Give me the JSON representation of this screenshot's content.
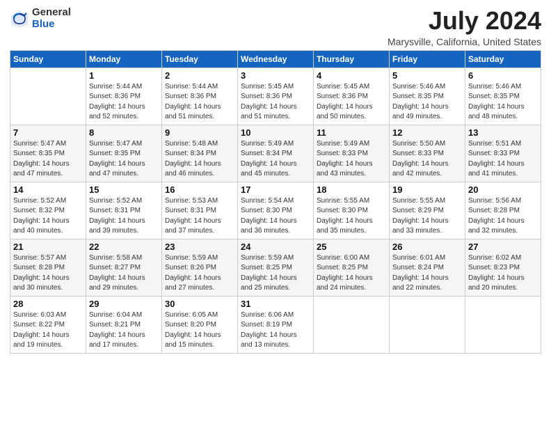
{
  "logo": {
    "general": "General",
    "blue": "Blue"
  },
  "title": {
    "month_year": "July 2024",
    "location": "Marysville, California, United States"
  },
  "headers": [
    "Sunday",
    "Monday",
    "Tuesday",
    "Wednesday",
    "Thursday",
    "Friday",
    "Saturday"
  ],
  "weeks": [
    [
      {
        "day": "",
        "sunrise": "",
        "sunset": "",
        "daylight": ""
      },
      {
        "day": "1",
        "sunrise": "Sunrise: 5:44 AM",
        "sunset": "Sunset: 8:36 PM",
        "daylight": "Daylight: 14 hours and 52 minutes."
      },
      {
        "day": "2",
        "sunrise": "Sunrise: 5:44 AM",
        "sunset": "Sunset: 8:36 PM",
        "daylight": "Daylight: 14 hours and 51 minutes."
      },
      {
        "day": "3",
        "sunrise": "Sunrise: 5:45 AM",
        "sunset": "Sunset: 8:36 PM",
        "daylight": "Daylight: 14 hours and 51 minutes."
      },
      {
        "day": "4",
        "sunrise": "Sunrise: 5:45 AM",
        "sunset": "Sunset: 8:36 PM",
        "daylight": "Daylight: 14 hours and 50 minutes."
      },
      {
        "day": "5",
        "sunrise": "Sunrise: 5:46 AM",
        "sunset": "Sunset: 8:35 PM",
        "daylight": "Daylight: 14 hours and 49 minutes."
      },
      {
        "day": "6",
        "sunrise": "Sunrise: 5:46 AM",
        "sunset": "Sunset: 8:35 PM",
        "daylight": "Daylight: 14 hours and 48 minutes."
      }
    ],
    [
      {
        "day": "7",
        "sunrise": "Sunrise: 5:47 AM",
        "sunset": "Sunset: 8:35 PM",
        "daylight": "Daylight: 14 hours and 47 minutes."
      },
      {
        "day": "8",
        "sunrise": "Sunrise: 5:47 AM",
        "sunset": "Sunset: 8:35 PM",
        "daylight": "Daylight: 14 hours and 47 minutes."
      },
      {
        "day": "9",
        "sunrise": "Sunrise: 5:48 AM",
        "sunset": "Sunset: 8:34 PM",
        "daylight": "Daylight: 14 hours and 46 minutes."
      },
      {
        "day": "10",
        "sunrise": "Sunrise: 5:49 AM",
        "sunset": "Sunset: 8:34 PM",
        "daylight": "Daylight: 14 hours and 45 minutes."
      },
      {
        "day": "11",
        "sunrise": "Sunrise: 5:49 AM",
        "sunset": "Sunset: 8:33 PM",
        "daylight": "Daylight: 14 hours and 43 minutes."
      },
      {
        "day": "12",
        "sunrise": "Sunrise: 5:50 AM",
        "sunset": "Sunset: 8:33 PM",
        "daylight": "Daylight: 14 hours and 42 minutes."
      },
      {
        "day": "13",
        "sunrise": "Sunrise: 5:51 AM",
        "sunset": "Sunset: 8:33 PM",
        "daylight": "Daylight: 14 hours and 41 minutes."
      }
    ],
    [
      {
        "day": "14",
        "sunrise": "Sunrise: 5:52 AM",
        "sunset": "Sunset: 8:32 PM",
        "daylight": "Daylight: 14 hours and 40 minutes."
      },
      {
        "day": "15",
        "sunrise": "Sunrise: 5:52 AM",
        "sunset": "Sunset: 8:31 PM",
        "daylight": "Daylight: 14 hours and 39 minutes."
      },
      {
        "day": "16",
        "sunrise": "Sunrise: 5:53 AM",
        "sunset": "Sunset: 8:31 PM",
        "daylight": "Daylight: 14 hours and 37 minutes."
      },
      {
        "day": "17",
        "sunrise": "Sunrise: 5:54 AM",
        "sunset": "Sunset: 8:30 PM",
        "daylight": "Daylight: 14 hours and 36 minutes."
      },
      {
        "day": "18",
        "sunrise": "Sunrise: 5:55 AM",
        "sunset": "Sunset: 8:30 PM",
        "daylight": "Daylight: 14 hours and 35 minutes."
      },
      {
        "day": "19",
        "sunrise": "Sunrise: 5:55 AM",
        "sunset": "Sunset: 8:29 PM",
        "daylight": "Daylight: 14 hours and 33 minutes."
      },
      {
        "day": "20",
        "sunrise": "Sunrise: 5:56 AM",
        "sunset": "Sunset: 8:28 PM",
        "daylight": "Daylight: 14 hours and 32 minutes."
      }
    ],
    [
      {
        "day": "21",
        "sunrise": "Sunrise: 5:57 AM",
        "sunset": "Sunset: 8:28 PM",
        "daylight": "Daylight: 14 hours and 30 minutes."
      },
      {
        "day": "22",
        "sunrise": "Sunrise: 5:58 AM",
        "sunset": "Sunset: 8:27 PM",
        "daylight": "Daylight: 14 hours and 29 minutes."
      },
      {
        "day": "23",
        "sunrise": "Sunrise: 5:59 AM",
        "sunset": "Sunset: 8:26 PM",
        "daylight": "Daylight: 14 hours and 27 minutes."
      },
      {
        "day": "24",
        "sunrise": "Sunrise: 5:59 AM",
        "sunset": "Sunset: 8:25 PM",
        "daylight": "Daylight: 14 hours and 25 minutes."
      },
      {
        "day": "25",
        "sunrise": "Sunrise: 6:00 AM",
        "sunset": "Sunset: 8:25 PM",
        "daylight": "Daylight: 14 hours and 24 minutes."
      },
      {
        "day": "26",
        "sunrise": "Sunrise: 6:01 AM",
        "sunset": "Sunset: 8:24 PM",
        "daylight": "Daylight: 14 hours and 22 minutes."
      },
      {
        "day": "27",
        "sunrise": "Sunrise: 6:02 AM",
        "sunset": "Sunset: 8:23 PM",
        "daylight": "Daylight: 14 hours and 20 minutes."
      }
    ],
    [
      {
        "day": "28",
        "sunrise": "Sunrise: 6:03 AM",
        "sunset": "Sunset: 8:22 PM",
        "daylight": "Daylight: 14 hours and 19 minutes."
      },
      {
        "day": "29",
        "sunrise": "Sunrise: 6:04 AM",
        "sunset": "Sunset: 8:21 PM",
        "daylight": "Daylight: 14 hours and 17 minutes."
      },
      {
        "day": "30",
        "sunrise": "Sunrise: 6:05 AM",
        "sunset": "Sunset: 8:20 PM",
        "daylight": "Daylight: 14 hours and 15 minutes."
      },
      {
        "day": "31",
        "sunrise": "Sunrise: 6:06 AM",
        "sunset": "Sunset: 8:19 PM",
        "daylight": "Daylight: 14 hours and 13 minutes."
      },
      {
        "day": "",
        "sunrise": "",
        "sunset": "",
        "daylight": ""
      },
      {
        "day": "",
        "sunrise": "",
        "sunset": "",
        "daylight": ""
      },
      {
        "day": "",
        "sunrise": "",
        "sunset": "",
        "daylight": ""
      }
    ]
  ]
}
